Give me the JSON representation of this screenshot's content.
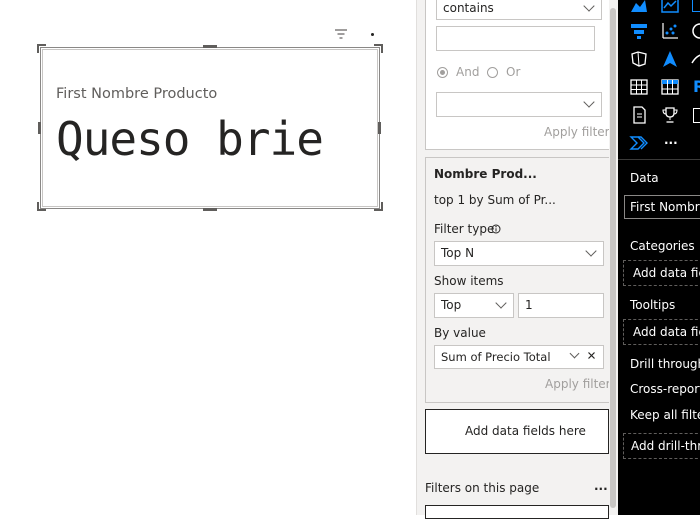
{
  "card": {
    "label": "First Nombre Producto",
    "value": "Queso brie"
  },
  "filters_pane": {
    "top_filter": {
      "operator": "contains",
      "input_value": "",
      "logic_and": "And",
      "logic_or": "Or",
      "second_operator": "",
      "apply_label": "Apply filter"
    },
    "nombre_filter": {
      "title": "Nombre Prod...",
      "summary": "top 1 by Sum of Pr...",
      "filter_type_label": "Filter type",
      "filter_type_value": "Top N",
      "show_items_label": "Show items",
      "show_items_direction": "Top",
      "show_items_count": "1",
      "by_value_label": "By value",
      "by_value_field": "Sum of Precio Total",
      "apply_label": "Apply filter"
    },
    "add_fields_label": "Add data fields here",
    "page_filters_label": "Filters on this page",
    "more_label": "..."
  },
  "viz_pane": {
    "data_label": "Data",
    "data_field": "First Nombre",
    "categories_label": "Categories",
    "categories_placeholder": "Add data fiel",
    "tooltips_label": "Tooltips",
    "tooltips_placeholder": "Add data fiel",
    "drill_through_label": "Drill through",
    "cross_report_label": "Cross-report",
    "keep_filters_label": "Keep all filters",
    "drill_placeholder": "Add drill-thro",
    "more_label": "...",
    "r_letter": "R",
    "accent": "#118dff"
  }
}
